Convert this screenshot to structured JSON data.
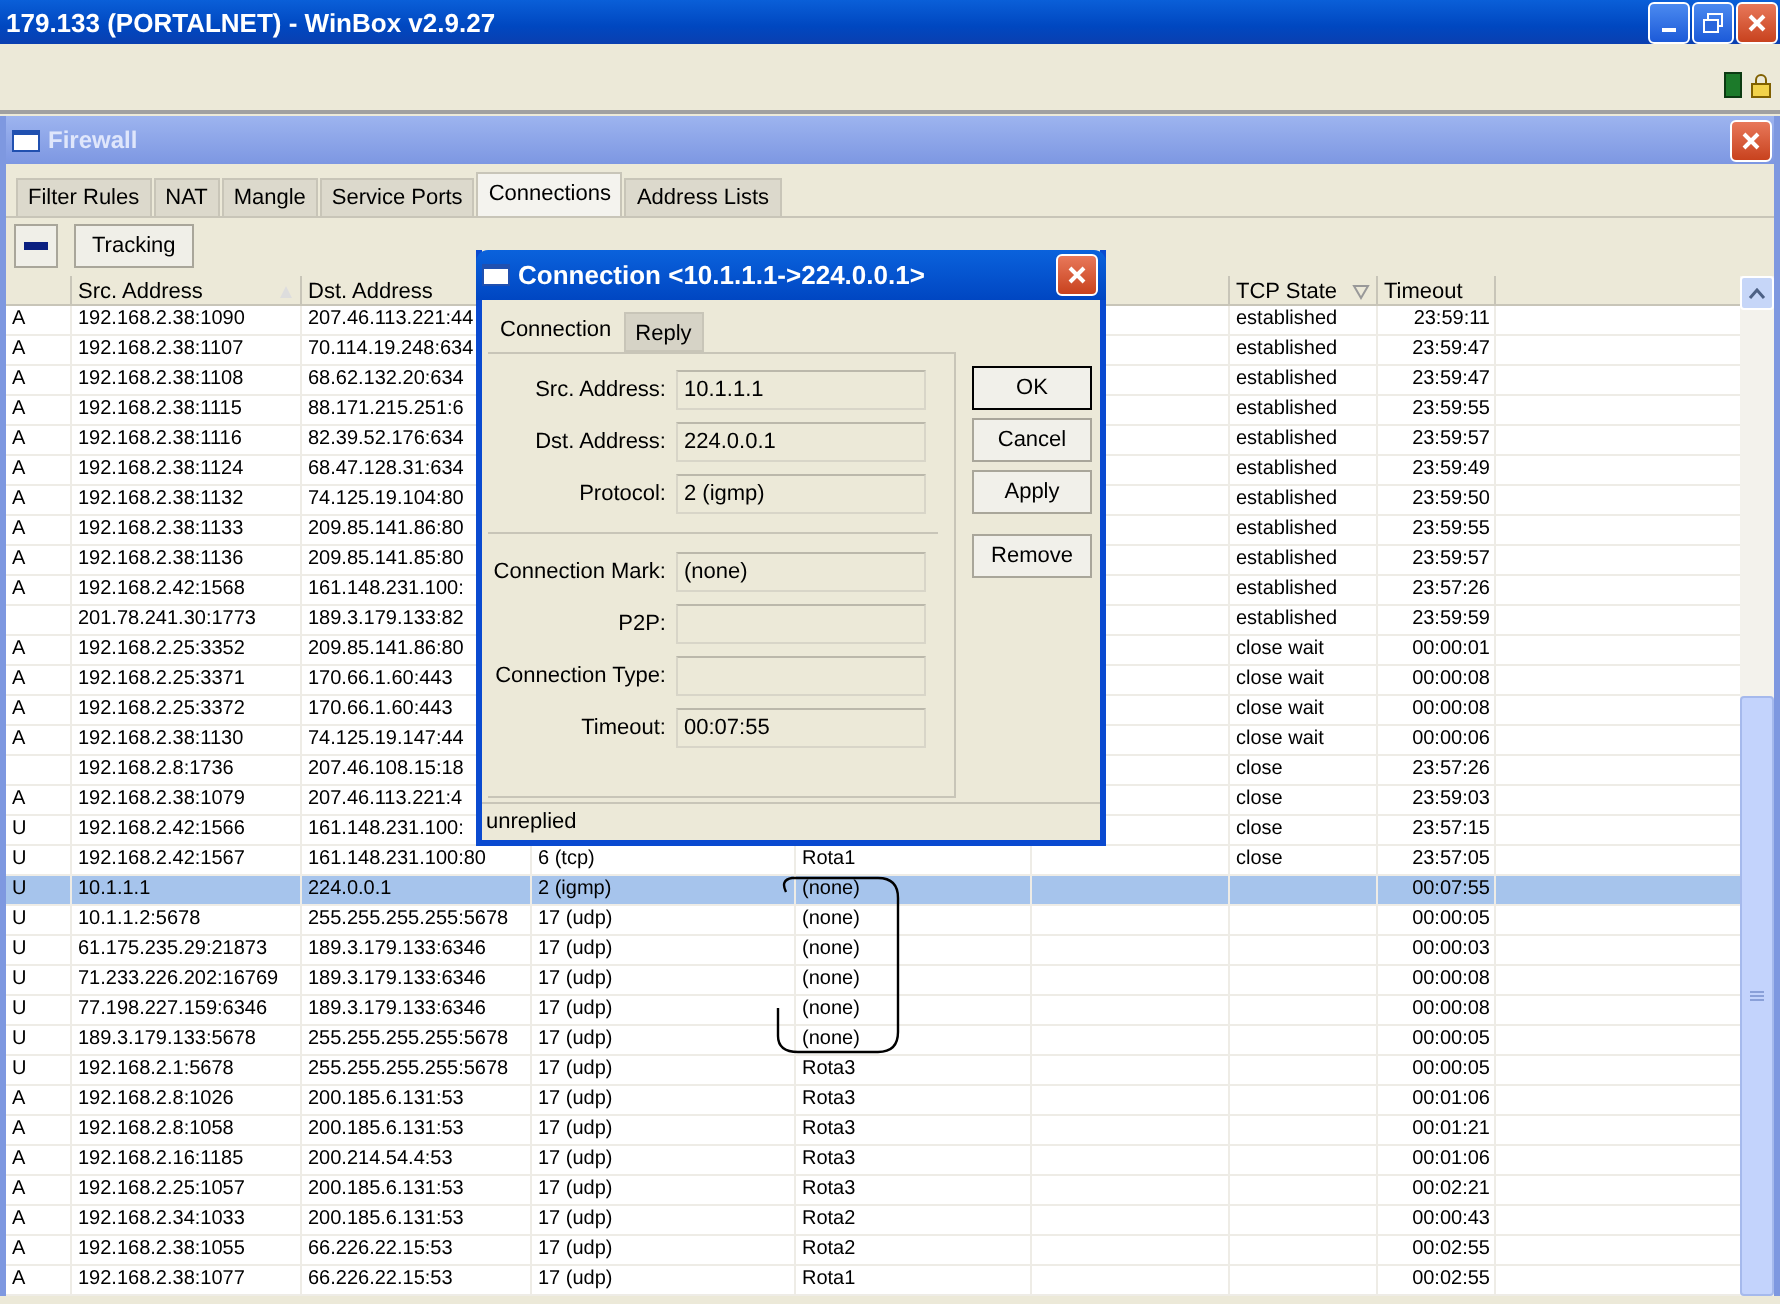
{
  "app_window": {
    "title": "179.133 (PORTALNET) - WinBox v2.9.27"
  },
  "firewall": {
    "title": "Firewall",
    "tabs": [
      {
        "label": "Filter Rules",
        "selected": false
      },
      {
        "label": "NAT",
        "selected": false
      },
      {
        "label": "Mangle",
        "selected": false
      },
      {
        "label": "Service Ports",
        "selected": false
      },
      {
        "label": "Connections",
        "selected": true
      },
      {
        "label": "Address Lists",
        "selected": false
      }
    ],
    "toolbar": {
      "tracking_button": "Tracking"
    },
    "table": {
      "headers": {
        "src": "Src. Address",
        "dst": "Dst. Address",
        "tcp_state": "TCP State",
        "timeout": "Timeout"
      },
      "rows": [
        {
          "flag": "A",
          "src": "192.168.2.38:1090",
          "dst": "207.46.113.221:44",
          "tcp_state": "established",
          "timeout": "23:59:11",
          "selected": false
        },
        {
          "flag": "A",
          "src": "192.168.2.38:1107",
          "dst": "70.114.19.248:634",
          "tcp_state": "established",
          "timeout": "23:59:47",
          "selected": false
        },
        {
          "flag": "A",
          "src": "192.168.2.38:1108",
          "dst": "68.62.132.20:634",
          "tcp_state": "established",
          "timeout": "23:59:47",
          "selected": false
        },
        {
          "flag": "A",
          "src": "192.168.2.38:1115",
          "dst": "88.171.215.251:6",
          "tcp_state": "established",
          "timeout": "23:59:55",
          "selected": false
        },
        {
          "flag": "A",
          "src": "192.168.2.38:1116",
          "dst": "82.39.52.176:634",
          "tcp_state": "established",
          "timeout": "23:59:57",
          "selected": false
        },
        {
          "flag": "A",
          "src": "192.168.2.38:1124",
          "dst": "68.47.128.31:634",
          "tcp_state": "established",
          "timeout": "23:59:49",
          "selected": false
        },
        {
          "flag": "A",
          "src": "192.168.2.38:1132",
          "dst": "74.125.19.104:80",
          "tcp_state": "established",
          "timeout": "23:59:50",
          "selected": false
        },
        {
          "flag": "A",
          "src": "192.168.2.38:1133",
          "dst": "209.85.141.86:80",
          "tcp_state": "established",
          "timeout": "23:59:55",
          "selected": false
        },
        {
          "flag": "A",
          "src": "192.168.2.38:1136",
          "dst": "209.85.141.85:80",
          "tcp_state": "established",
          "timeout": "23:59:57",
          "selected": false
        },
        {
          "flag": "A",
          "src": "192.168.2.42:1568",
          "dst": "161.148.231.100:",
          "tcp_state": "established",
          "timeout": "23:57:26",
          "selected": false
        },
        {
          "src": "201.78.241.30:1773",
          "dst": "189.3.179.133:82",
          "tcp_state": "established",
          "timeout": "23:59:59",
          "selected": false
        },
        {
          "flag": "A",
          "src": "192.168.2.25:3352",
          "dst": "209.85.141.86:80",
          "tcp_state": "close wait",
          "timeout": "00:00:01",
          "selected": false
        },
        {
          "flag": "A",
          "src": "192.168.2.25:3371",
          "dst": "170.66.1.60:443",
          "tcp_state": "close wait",
          "timeout": "00:00:08",
          "selected": false
        },
        {
          "flag": "A",
          "src": "192.168.2.25:3372",
          "dst": "170.66.1.60:443",
          "tcp_state": "close wait",
          "timeout": "00:00:08",
          "selected": false
        },
        {
          "flag": "A",
          "src": "192.168.2.38:1130",
          "dst": "74.125.19.147:44",
          "tcp_state": "close wait",
          "timeout": "00:00:06",
          "selected": false
        },
        {
          "src": "192.168.2.8:1736",
          "dst": "207.46.108.15:18",
          "tcp_state": "close",
          "timeout": "23:57:26",
          "selected": false
        },
        {
          "flag": "A",
          "src": "192.168.2.38:1079",
          "dst": "207.46.113.221:4",
          "tcp_state": "close",
          "timeout": "23:59:03",
          "selected": false
        },
        {
          "flag": "U",
          "src": "192.168.2.42:1566",
          "dst": "161.148.231.100:",
          "tcp_state": "close",
          "timeout": "23:57:15",
          "selected": false
        },
        {
          "flag": "U",
          "src": "192.168.2.42:1567",
          "dst": "161.148.231.100:80",
          "protocol": "6 (tcp)",
          "mark": "Rota1",
          "tcp_state": "close",
          "timeout": "23:57:05",
          "selected": false
        },
        {
          "flag": "U",
          "src": "10.1.1.1",
          "dst": "224.0.0.1",
          "protocol": "2 (igmp)",
          "mark": "(none)",
          "timeout": "00:07:55",
          "selected": true
        },
        {
          "flag": "U",
          "src": "10.1.1.2:5678",
          "dst": "255.255.255.255:5678",
          "protocol": "17 (udp)",
          "mark": "(none)",
          "timeout": "00:00:05",
          "selected": false
        },
        {
          "flag": "U",
          "src": "61.175.235.29:21873",
          "dst": "189.3.179.133:6346",
          "protocol": "17 (udp)",
          "mark": "(none)",
          "timeout": "00:00:03",
          "selected": false
        },
        {
          "flag": "U",
          "src": "71.233.226.202:16769",
          "dst": "189.3.179.133:6346",
          "protocol": "17 (udp)",
          "mark": "(none)",
          "timeout": "00:00:08",
          "selected": false
        },
        {
          "flag": "U",
          "src": "77.198.227.159:6346",
          "dst": "189.3.179.133:6346",
          "protocol": "17 (udp)",
          "mark": "(none)",
          "timeout": "00:00:08",
          "selected": false
        },
        {
          "flag": "U",
          "src": "189.3.179.133:5678",
          "dst": "255.255.255.255:5678",
          "protocol": "17 (udp)",
          "mark": "(none)",
          "timeout": "00:00:05",
          "selected": false
        },
        {
          "flag": "U",
          "src": "192.168.2.1:5678",
          "dst": "255.255.255.255:5678",
          "protocol": "17 (udp)",
          "mark": "Rota3",
          "timeout": "00:00:05",
          "selected": false
        },
        {
          "flag": "A",
          "src": "192.168.2.8:1026",
          "dst": "200.185.6.131:53",
          "protocol": "17 (udp)",
          "mark": "Rota3",
          "timeout": "00:01:06",
          "selected": false
        },
        {
          "flag": "A",
          "src": "192.168.2.8:1058",
          "dst": "200.185.6.131:53",
          "protocol": "17 (udp)",
          "mark": "Rota3",
          "timeout": "00:01:21",
          "selected": false
        },
        {
          "flag": "A",
          "src": "192.168.2.16:1185",
          "dst": "200.214.54.4:53",
          "protocol": "17 (udp)",
          "mark": "Rota3",
          "timeout": "00:01:06",
          "selected": false
        },
        {
          "flag": "A",
          "src": "192.168.2.25:1057",
          "dst": "200.185.6.131:53",
          "protocol": "17 (udp)",
          "mark": "Rota3",
          "timeout": "00:02:21",
          "selected": false
        },
        {
          "flag": "A",
          "src": "192.168.2.34:1033",
          "dst": "200.185.6.131:53",
          "protocol": "17 (udp)",
          "mark": "Rota2",
          "timeout": "00:00:43",
          "selected": false
        },
        {
          "flag": "A",
          "src": "192.168.2.38:1055",
          "dst": "66.226.22.15:53",
          "protocol": "17 (udp)",
          "mark": "Rota2",
          "timeout": "00:02:55",
          "selected": false
        },
        {
          "flag": "A",
          "src": "192.168.2.38:1077",
          "dst": "66.226.22.15:53",
          "protocol": "17 (udp)",
          "mark": "Rota1",
          "timeout": "00:02:55",
          "selected": false
        }
      ]
    }
  },
  "dialog": {
    "title": "Connection <10.1.1.1->224.0.0.1>",
    "tabs": [
      {
        "label": "Connection",
        "selected": true
      },
      {
        "label": "Reply",
        "selected": false
      }
    ],
    "groups": [
      [
        {
          "label": "Src. Address:",
          "value": "10.1.1.1"
        },
        {
          "label": "Dst. Address:",
          "value": "224.0.0.1"
        },
        {
          "label": "Protocol:",
          "value": "2 (igmp)"
        }
      ],
      [
        {
          "label": "Connection Mark:",
          "value": "(none)"
        },
        {
          "label": "P2P:"
        },
        {
          "label": "Connection Type:"
        },
        {
          "label": "Timeout:",
          "value": "00:07:55"
        }
      ]
    ],
    "buttons": [
      "OK",
      "Cancel",
      "Apply",
      "Remove"
    ],
    "status": "unreplied"
  }
}
